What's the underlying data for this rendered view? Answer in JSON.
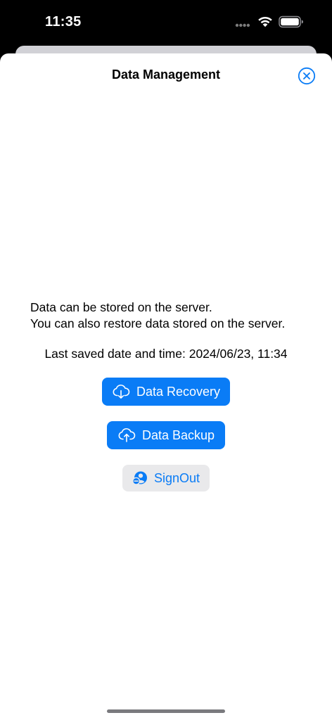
{
  "status_bar": {
    "time": "11:35",
    "icons": [
      "signal-dots-icon",
      "wifi-icon",
      "battery-icon"
    ]
  },
  "sheet": {
    "title": "Data Management",
    "close_icon": "close-circle-icon"
  },
  "content": {
    "description_line1": "Data can be stored on the server.",
    "description_line2": "You can also restore data stored on the server.",
    "last_saved": "Last saved date and time: 2024/06/23, 11:34"
  },
  "buttons": {
    "recovery": {
      "label": "Data Recovery",
      "icon": "cloud-download-icon"
    },
    "backup": {
      "label": "Data Backup",
      "icon": "cloud-upload-icon"
    },
    "signout": {
      "label": "SignOut",
      "icon": "person-minus-icon"
    }
  },
  "colors": {
    "accent": "#0a7cf6",
    "secondary_button_bg": "#e9e9eb",
    "status_bar_bg": "#000000",
    "sheet_bg": "#ffffff"
  }
}
